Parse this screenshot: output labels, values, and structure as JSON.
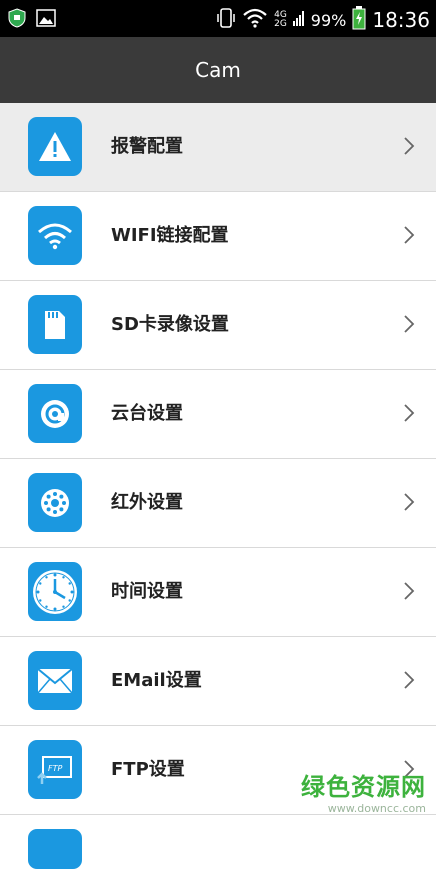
{
  "status_bar": {
    "network_top": "4G",
    "network_bottom": "2G",
    "battery_percent": "99%",
    "time": "18:36"
  },
  "app_bar": {
    "title": "Cam"
  },
  "menu": {
    "items": [
      {
        "label": "报警配置",
        "icon": "alarm-warning-icon"
      },
      {
        "label": "WIFI链接配置",
        "icon": "wifi-icon"
      },
      {
        "label": "SD卡录像设置",
        "icon": "sd-card-icon"
      },
      {
        "label": "云台设置",
        "icon": "ptz-icon"
      },
      {
        "label": "红外设置",
        "icon": "infrared-icon"
      },
      {
        "label": "时间设置",
        "icon": "clock-icon"
      },
      {
        "label": "EMail设置",
        "icon": "email-icon"
      },
      {
        "label": "FTP设置",
        "icon": "ftp-icon"
      }
    ]
  },
  "watermark": {
    "main": "绿色资源网",
    "sub": "www.downcc.com"
  },
  "colors": {
    "icon_bg": "#1b98e0",
    "app_bar": "#3a3a3a",
    "status_bar": "#000000",
    "watermark": "#3db23d"
  }
}
